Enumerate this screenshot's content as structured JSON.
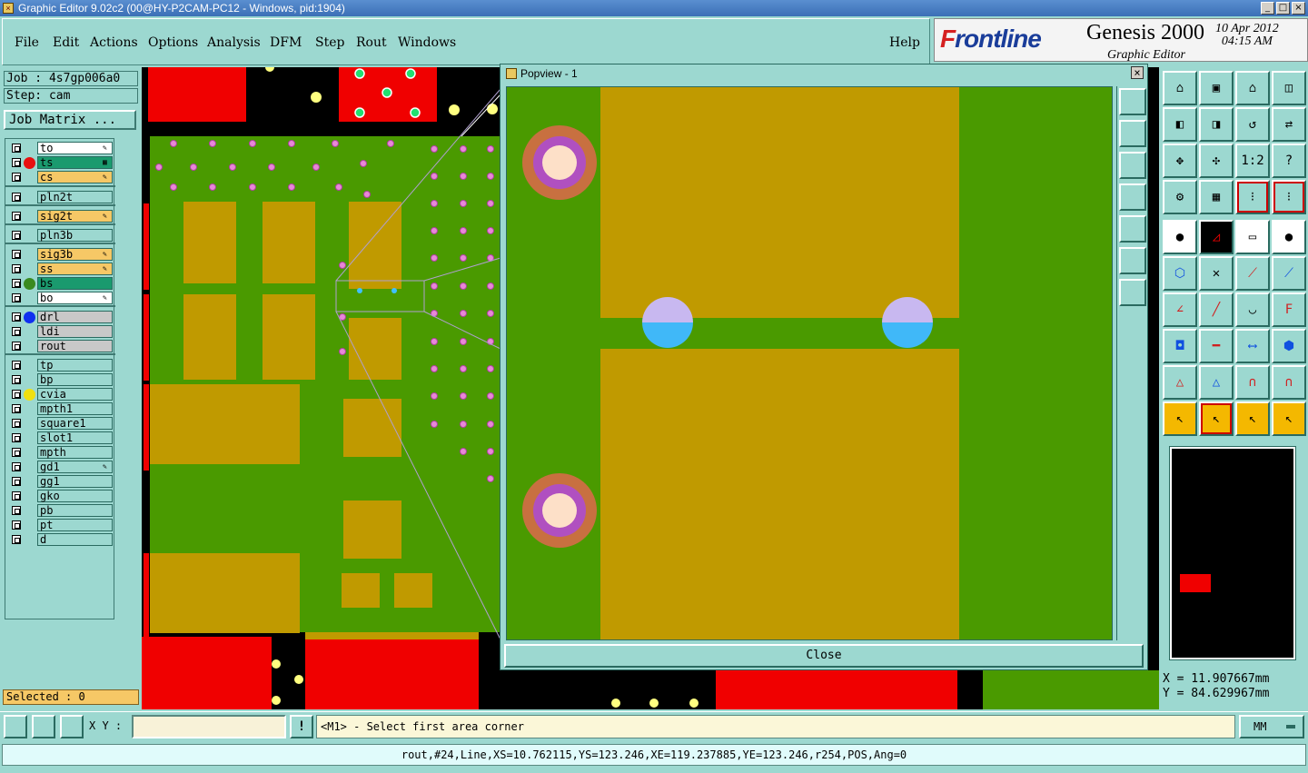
{
  "window": {
    "title": "Graphic Editor 9.02c2 (00@HY-P2CAM-PC12 - Windows, pid:1904)",
    "minimize": "_",
    "maximize": "□",
    "close": "×"
  },
  "menu": {
    "items": [
      "File",
      "Edit",
      "Actions",
      "Options",
      "Analysis",
      "DFM",
      "Step",
      "Rout",
      "Windows"
    ],
    "help": "Help"
  },
  "brand": {
    "logo_f": "F",
    "logo_rest": "rontline",
    "product": "Genesis 2000",
    "module": "Graphic Editor",
    "date": "10 Apr 2012",
    "time": "04:15 AM"
  },
  "job": {
    "job_label": "Job : 4s7gp006a0",
    "step_label": "Step: cam",
    "matrix_button": "Job Matrix ..."
  },
  "layers": [
    {
      "name": "to",
      "bg": "#ffffff",
      "dot": "",
      "flag": "✎"
    },
    {
      "name": "ts",
      "bg": "#1a9a6e",
      "dot": "#e81010",
      "flag": "▦"
    },
    {
      "name": "cs",
      "bg": "#f6c866",
      "dot": "",
      "flag": "✎"
    },
    {
      "name": "pln2t",
      "bg": "#9cd8d0",
      "dot": "",
      "flag": ""
    },
    {
      "name": "sig2t",
      "bg": "#f6c866",
      "dot": "",
      "flag": "✎"
    },
    {
      "name": "pln3b",
      "bg": "#9cd8d0",
      "dot": "",
      "flag": ""
    },
    {
      "name": "sig3b",
      "bg": "#f6c866",
      "dot": "",
      "flag": "✎"
    },
    {
      "name": "ss",
      "bg": "#f6c866",
      "dot": "",
      "flag": "✎"
    },
    {
      "name": "bs",
      "bg": "#1a9a6e",
      "dot": "#3a8a20",
      "flag": ""
    },
    {
      "name": "bo",
      "bg": "#ffffff",
      "dot": "",
      "flag": "✎"
    },
    {
      "name": "drl",
      "bg": "#c8c8c8",
      "dot": "#1030f0",
      "flag": ""
    },
    {
      "name": "ldi",
      "bg": "#c8c8c8",
      "dot": "",
      "flag": ""
    },
    {
      "name": "rout",
      "bg": "#c8c8c8",
      "dot": "",
      "flag": ""
    },
    {
      "name": "tp",
      "bg": "#9cd8d0",
      "dot": "",
      "flag": ""
    },
    {
      "name": "bp",
      "bg": "#9cd8d0",
      "dot": "",
      "flag": ""
    },
    {
      "name": "cvia",
      "bg": "#9cd8d0",
      "dot": "#f0e010",
      "flag": ""
    },
    {
      "name": "mpth1",
      "bg": "#9cd8d0",
      "dot": "",
      "flag": ""
    },
    {
      "name": "square1",
      "bg": "#9cd8d0",
      "dot": "",
      "flag": ""
    },
    {
      "name": "slot1",
      "bg": "#9cd8d0",
      "dot": "",
      "flag": ""
    },
    {
      "name": "mpth",
      "bg": "#9cd8d0",
      "dot": "",
      "flag": ""
    },
    {
      "name": "gd1",
      "bg": "#9cd8d0",
      "dot": "",
      "flag": "✎"
    },
    {
      "name": "gg1",
      "bg": "#9cd8d0",
      "dot": "",
      "flag": ""
    },
    {
      "name": "gko",
      "bg": "#9cd8d0",
      "dot": "",
      "flag": ""
    },
    {
      "name": "pb",
      "bg": "#9cd8d0",
      "dot": "",
      "flag": ""
    },
    {
      "name": "pt",
      "bg": "#9cd8d0",
      "dot": "",
      "flag": ""
    },
    {
      "name": "d",
      "bg": "#9cd8d0",
      "dot": "",
      "flag": ""
    }
  ],
  "selected": "Selected : 0",
  "popview": {
    "title": "Popview - 1",
    "close_x": "×",
    "close_button": "Close"
  },
  "toolbox": {
    "ratio_label": "1:2",
    "help_label": "?"
  },
  "coords": {
    "x": "X =  11.907667mm",
    "y": "Y =  84.629967mm"
  },
  "command": {
    "xy_label": "X Y :",
    "xy_value": "",
    "bang": "!",
    "prompt": "<M1> - Select first area corner",
    "units": "MM"
  },
  "status": "rout,#24,Line,XS=10.762115,YS=123.246,XE=119.237885,YE=123.246,r254,POS,Ang=0",
  "colors": {
    "copper": "#c09a00",
    "mask": "#4a9a00",
    "red": "#f00000",
    "panel": "#9cd8d0"
  }
}
